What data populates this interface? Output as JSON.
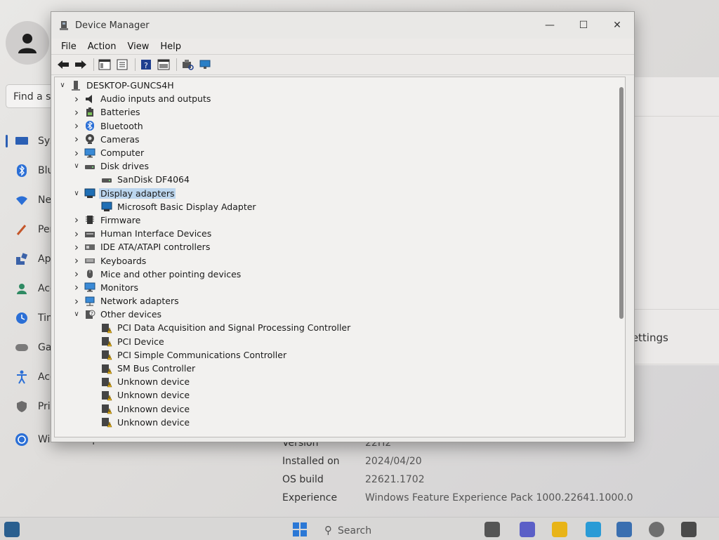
{
  "settings": {
    "search_placeholder": "Find a se",
    "nav": [
      {
        "label": "Sys",
        "icon": "system-icon"
      },
      {
        "label": "Blu",
        "icon": "bluetooth-icon"
      },
      {
        "label": "Ne",
        "icon": "network-icon"
      },
      {
        "label": "Per",
        "icon": "personalization-icon"
      },
      {
        "label": "Ap",
        "icon": "apps-icon"
      },
      {
        "label": "Acc",
        "icon": "accounts-icon"
      },
      {
        "label": "Tim",
        "icon": "time-icon"
      },
      {
        "label": "Ga",
        "icon": "gaming-icon"
      },
      {
        "label": "Acc",
        "icon": "accessibility-icon"
      },
      {
        "label": "Priv",
        "icon": "privacy-icon"
      }
    ],
    "windows_update": "Windows Update",
    "settings_link": "settings",
    "specs": [
      {
        "key": "Version",
        "value": "22H2"
      },
      {
        "key": "Installed on",
        "value": "2024/04/20"
      },
      {
        "key": "OS build",
        "value": "22621.1702"
      },
      {
        "key": "Experience",
        "value": "Windows Feature Experience Pack 1000.22641.1000.0"
      }
    ]
  },
  "taskbar": {
    "search_label": "Search"
  },
  "device_manager": {
    "title": "Device Manager",
    "menu": [
      "File",
      "Action",
      "View",
      "Help"
    ],
    "tree": [
      {
        "label": "DESKTOP-GUNCS4H",
        "level": 0,
        "state": "expanded",
        "icon": "computer-icon"
      },
      {
        "label": "Audio inputs and outputs",
        "level": 1,
        "state": "collapsed",
        "icon": "speaker-icon"
      },
      {
        "label": "Batteries",
        "level": 1,
        "state": "collapsed",
        "icon": "battery-icon"
      },
      {
        "label": "Bluetooth",
        "level": 1,
        "state": "collapsed",
        "icon": "bluetooth-icon"
      },
      {
        "label": "Cameras",
        "level": 1,
        "state": "collapsed",
        "icon": "camera-icon"
      },
      {
        "label": "Computer",
        "level": 1,
        "state": "collapsed",
        "icon": "monitor-icon"
      },
      {
        "label": "Disk drives",
        "level": 1,
        "state": "expanded",
        "icon": "disk-icon"
      },
      {
        "label": "SanDisk DF4064",
        "level": 2,
        "state": "leaf",
        "icon": "disk-icon"
      },
      {
        "label": "Display adapters",
        "level": 1,
        "state": "expanded",
        "icon": "display-adapter-icon",
        "selected": true
      },
      {
        "label": "Microsoft Basic Display Adapter",
        "level": 2,
        "state": "leaf",
        "icon": "display-adapter-icon"
      },
      {
        "label": "Firmware",
        "level": 1,
        "state": "collapsed",
        "icon": "chip-icon"
      },
      {
        "label": "Human Interface Devices",
        "level": 1,
        "state": "collapsed",
        "icon": "hid-icon"
      },
      {
        "label": "IDE ATA/ATAPI controllers",
        "level": 1,
        "state": "collapsed",
        "icon": "controller-icon"
      },
      {
        "label": "Keyboards",
        "level": 1,
        "state": "collapsed",
        "icon": "keyboard-icon"
      },
      {
        "label": "Mice and other pointing devices",
        "level": 1,
        "state": "collapsed",
        "icon": "mouse-icon"
      },
      {
        "label": "Monitors",
        "level": 1,
        "state": "collapsed",
        "icon": "monitor-icon"
      },
      {
        "label": "Network adapters",
        "level": 1,
        "state": "collapsed",
        "icon": "network-icon"
      },
      {
        "label": "Other devices",
        "level": 1,
        "state": "expanded",
        "icon": "unknown-device-icon"
      },
      {
        "label": "PCI Data Acquisition and Signal Processing Controller",
        "level": 2,
        "state": "leaf",
        "icon": "warning-device-icon"
      },
      {
        "label": "PCI Device",
        "level": 2,
        "state": "leaf",
        "icon": "warning-device-icon"
      },
      {
        "label": "PCI Simple Communications Controller",
        "level": 2,
        "state": "leaf",
        "icon": "warning-device-icon"
      },
      {
        "label": "SM Bus Controller",
        "level": 2,
        "state": "leaf",
        "icon": "warning-device-icon"
      },
      {
        "label": "Unknown device",
        "level": 2,
        "state": "leaf",
        "icon": "warning-device-icon"
      },
      {
        "label": "Unknown device",
        "level": 2,
        "state": "leaf",
        "icon": "warning-device-icon"
      },
      {
        "label": "Unknown device",
        "level": 2,
        "state": "leaf",
        "icon": "warning-device-icon"
      },
      {
        "label": "Unknown device",
        "level": 2,
        "state": "leaf",
        "icon": "warning-device-icon"
      }
    ]
  },
  "colors": {
    "selection": "#bcd6ee",
    "accent": "#2b5fb4",
    "warning": "#e8b418"
  }
}
